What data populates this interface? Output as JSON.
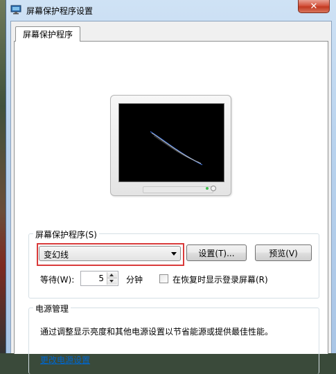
{
  "window": {
    "title": "屏幕保护程序设置",
    "close_symbol": "✕",
    "icon": "screensaver-settings-icon"
  },
  "tabs": [
    {
      "label": "屏幕保护程序",
      "active": true
    }
  ],
  "screensaver": {
    "group_label": "屏幕保护程序(S)",
    "selected": "变幻线",
    "settings_button": "设置(T)...",
    "preview_button": "预览(V)",
    "wait_label": "等待(W):",
    "wait_value": "5",
    "minutes_label": "分钟",
    "logon_checkbox_label": "在恢复时显示登录屏幕(R)",
    "logon_checked": false
  },
  "power": {
    "group_label": "电源管理",
    "description": "通过调整显示亮度和其他电源设置以节省能源或提供最佳性能。",
    "link": "更改电源设置"
  },
  "colors": {
    "highlight": "#d93a3a",
    "link": "#0066cc"
  }
}
